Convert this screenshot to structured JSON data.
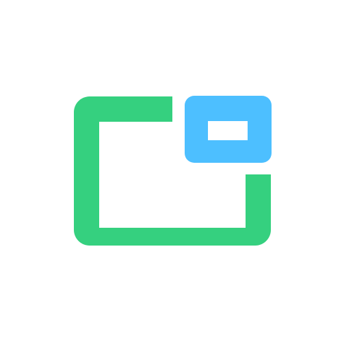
{
  "icon": {
    "name": "picture-in-picture-icon",
    "colors": {
      "frame": "#35D07F",
      "mini_window": "#4DBFFF",
      "background": "#FFFFFF"
    }
  }
}
